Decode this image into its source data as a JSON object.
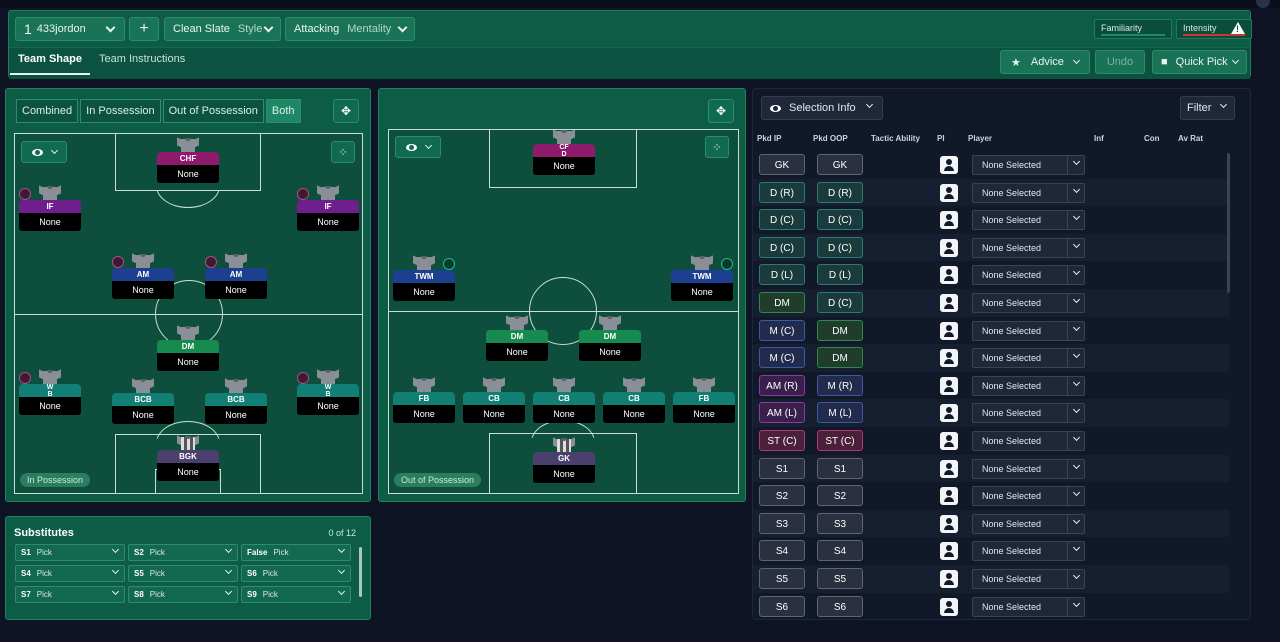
{
  "header": {
    "tactic_number": "1",
    "tactic_name": "433jordon",
    "add_label": "+",
    "style_value": "Clean Slate",
    "style_label": "Style",
    "mentality_value": "Attacking",
    "mentality_label": "Mentality",
    "familiarity_label": "Familiarity",
    "intensity_label": "Intensity",
    "tabs": [
      "Team Shape",
      "Team Instructions"
    ],
    "advice_label": "Advice",
    "undo_label": "Undo",
    "quick_pick_label": "Quick Pick"
  },
  "in_panel": {
    "segments": [
      "Combined",
      "In Possession",
      "Out of Possession",
      "Both"
    ],
    "pill": "In Possession",
    "slots": [
      {
        "role": "CHF",
        "name": "None"
      },
      {
        "role": "IF",
        "name": "None"
      },
      {
        "role": "IF",
        "name": "None"
      },
      {
        "role": "AM",
        "name": "None"
      },
      {
        "role": "AM",
        "name": "None"
      },
      {
        "role": "DM",
        "name": "None"
      },
      {
        "role": "W\nB",
        "name": "None"
      },
      {
        "role": "BCB",
        "name": "None"
      },
      {
        "role": "BCB",
        "name": "None"
      },
      {
        "role": "W\nB",
        "name": "None"
      },
      {
        "role": "BGK",
        "name": "None"
      }
    ]
  },
  "out_panel": {
    "pill": "Out of Possession",
    "slots": [
      {
        "role": "CF\nD",
        "name": "None"
      },
      {
        "role": "TWM",
        "name": "None"
      },
      {
        "role": "TWM",
        "name": "None"
      },
      {
        "role": "DM",
        "name": "None"
      },
      {
        "role": "DM",
        "name": "None"
      },
      {
        "role": "FB",
        "name": "None"
      },
      {
        "role": "CB",
        "name": "None"
      },
      {
        "role": "CB",
        "name": "None"
      },
      {
        "role": "CB",
        "name": "None"
      },
      {
        "role": "FB",
        "name": "None"
      },
      {
        "role": "GK",
        "name": "None"
      }
    ]
  },
  "substitutes": {
    "title": "Substitutes",
    "count": "0 of 12",
    "cells": [
      {
        "slot": "S1",
        "value": "Pick"
      },
      {
        "slot": "S2",
        "value": "Pick"
      },
      {
        "slot": "False",
        "value": "Pick"
      },
      {
        "slot": "S4",
        "value": "Pick"
      },
      {
        "slot": "S5",
        "value": "Pick"
      },
      {
        "slot": "S6",
        "value": "Pick"
      },
      {
        "slot": "S7",
        "value": "Pick"
      },
      {
        "slot": "S8",
        "value": "Pick"
      },
      {
        "slot": "S9",
        "value": "Pick"
      }
    ]
  },
  "selection": {
    "info_label": "Selection Info",
    "filter_label": "Filter",
    "columns": [
      "Pkd IP",
      "Pkd OOP",
      "Tactic Ability",
      "PI",
      "Player",
      "Inf",
      "Con",
      "Av Rat"
    ],
    "rows": [
      {
        "ip": "GK",
        "oop": "GK",
        "player": "None Selected"
      },
      {
        "ip": "D (R)",
        "oop": "D (R)",
        "player": "None Selected"
      },
      {
        "ip": "D (C)",
        "oop": "D (C)",
        "player": "None Selected"
      },
      {
        "ip": "D (C)",
        "oop": "D (C)",
        "player": "None Selected"
      },
      {
        "ip": "D (L)",
        "oop": "D (L)",
        "player": "None Selected"
      },
      {
        "ip": "DM",
        "oop": "D (C)",
        "player": "None Selected"
      },
      {
        "ip": "M (C)",
        "oop": "DM",
        "player": "None Selected"
      },
      {
        "ip": "M (C)",
        "oop": "DM",
        "player": "None Selected"
      },
      {
        "ip": "AM (R)",
        "oop": "M (R)",
        "player": "None Selected"
      },
      {
        "ip": "AM (L)",
        "oop": "M (L)",
        "player": "None Selected"
      },
      {
        "ip": "ST (C)",
        "oop": "ST (C)",
        "player": "None Selected"
      },
      {
        "ip": "S1",
        "oop": "S1",
        "player": "None Selected"
      },
      {
        "ip": "S2",
        "oop": "S2",
        "player": "None Selected"
      },
      {
        "ip": "S3",
        "oop": "S3",
        "player": "None Selected"
      },
      {
        "ip": "S4",
        "oop": "S4",
        "player": "None Selected"
      },
      {
        "ip": "S5",
        "oop": "S5",
        "player": "None Selected"
      },
      {
        "ip": "S6",
        "oop": "S6",
        "player": "None Selected"
      }
    ]
  }
}
